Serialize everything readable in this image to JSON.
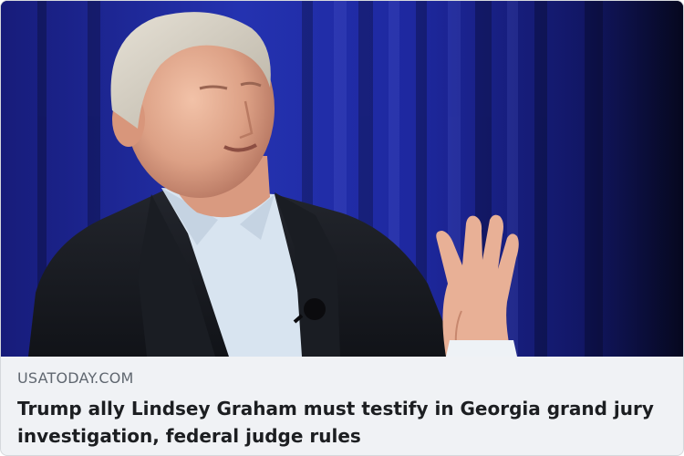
{
  "link_preview": {
    "image_alt": "Lindsey Graham speaking in front of a blue curtain",
    "domain": "USATODAY.COM",
    "headline": "Trump ally Lindsey Graham must testify in Georgia grand jury investigation, federal judge rules"
  },
  "colors": {
    "card_background": "#f0f2f5",
    "domain_text": "#606770",
    "headline_text": "#1c1e21",
    "backdrop_blue": "#1b2490"
  }
}
